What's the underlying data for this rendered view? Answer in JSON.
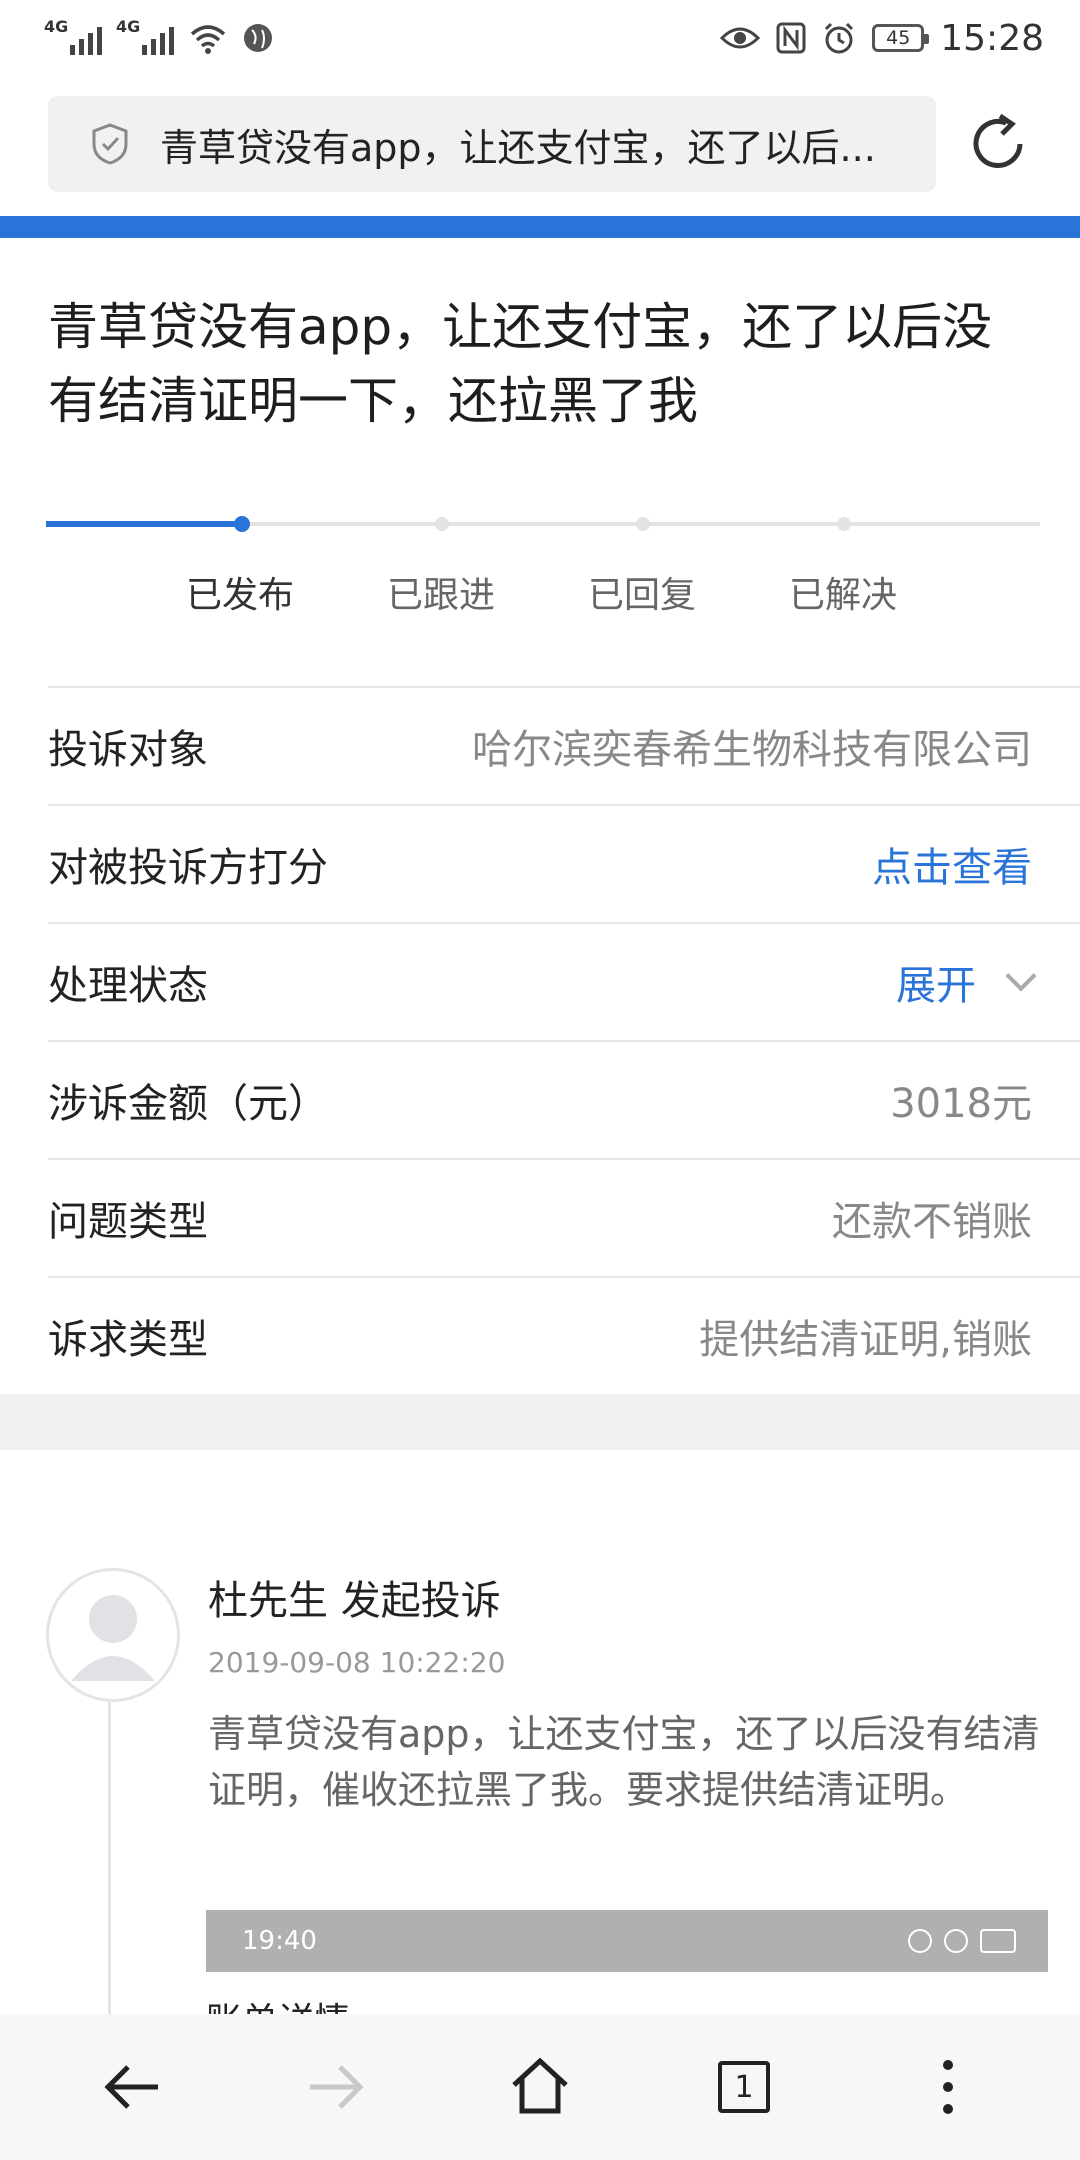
{
  "status_bar": {
    "net1": "4G",
    "net2": "4G",
    "battery": "45",
    "time": "15:28"
  },
  "url_bar": {
    "text": "青草贷没有app，让还支付宝，还了以后..."
  },
  "complaint": {
    "title": "青草贷没有app，让还支付宝，还了以后没有结清证明一下，还拉黑了我"
  },
  "progress_steps": [
    {
      "label": "已发布",
      "active": true
    },
    {
      "label": "已跟进",
      "active": false
    },
    {
      "label": "已回复",
      "active": false
    },
    {
      "label": "已解决",
      "active": false
    }
  ],
  "details": {
    "target_label": "投诉对象",
    "target_value": "哈尔滨奕春希生物科技有限公司",
    "rating_label": "对被投诉方打分",
    "rating_value": "点击查看",
    "status_label": "处理状态",
    "status_value": "展开",
    "amount_label": "涉诉金额（元）",
    "amount_value": "3018元",
    "issue_label": "问题类型",
    "issue_value": "还款不销账",
    "demand_label": "诉求类型",
    "demand_value": "提供结清证明,销账"
  },
  "timeline": {
    "author": "杜先生 发起投诉",
    "time": "2019-09-08 10:22:20",
    "text": "青草贷没有app，让还支付宝，还了以后没有结清证明，催收还拉黑了我。要求提供结清证明。",
    "screenshot_time": "19:40",
    "screenshot_subtitle": "账单详情"
  },
  "bottom_nav": {
    "tab_count": "1"
  },
  "colors": {
    "accent": "#2a73d9",
    "muted_text": "#888888"
  }
}
